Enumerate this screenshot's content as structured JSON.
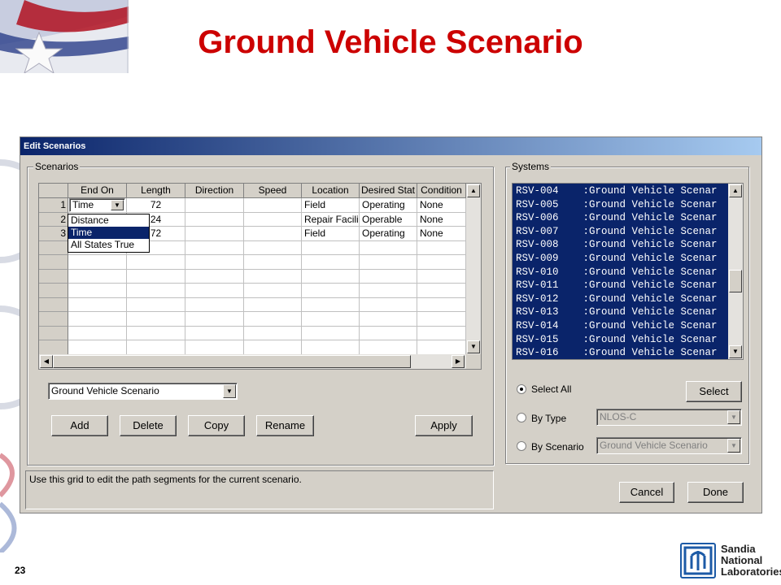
{
  "slide": {
    "title": "Ground Vehicle Scenario",
    "page_number": "23",
    "logo_text": [
      "Sandia",
      "National",
      "Laboratories"
    ]
  },
  "window": {
    "title": "Edit Scenarios",
    "scenarios_label": "Scenarios",
    "systems_label": "Systems",
    "grid": {
      "columns": [
        "End On",
        "Length",
        "Direction",
        "Speed",
        "Location",
        "Desired Stat",
        "Condition"
      ],
      "rows": [
        {
          "num": "1",
          "end_on": "Time",
          "length": "72",
          "direction": "",
          "speed": "",
          "location": "Field",
          "desired_state": "Operating",
          "condition": "None"
        },
        {
          "num": "2",
          "end_on": "",
          "length": "24",
          "direction": "",
          "speed": "",
          "location": "Repair Facili",
          "desired_state": "Operable",
          "condition": "None"
        },
        {
          "num": "3",
          "end_on": "",
          "length": "72",
          "direction": "",
          "speed": "",
          "location": "Field",
          "desired_state": "Operating",
          "condition": "None"
        }
      ],
      "end_on_options": [
        "Distance",
        "Time",
        "All States True"
      ],
      "end_on_selected": "Time"
    },
    "scenario_select": "Ground Vehicle Scenario",
    "buttons": {
      "add": "Add",
      "delete": "Delete",
      "copy": "Copy",
      "rename": "Rename",
      "apply": "Apply",
      "select": "Select",
      "cancel": "Cancel",
      "done": "Done"
    },
    "systems": [
      {
        "id": "RSV-004",
        "name": ":Ground Vehicle Scenar"
      },
      {
        "id": "RSV-005",
        "name": ":Ground Vehicle Scenar"
      },
      {
        "id": "RSV-006",
        "name": ":Ground Vehicle Scenar"
      },
      {
        "id": "RSV-007",
        "name": ":Ground Vehicle Scenar"
      },
      {
        "id": "RSV-008",
        "name": ":Ground Vehicle Scenar"
      },
      {
        "id": "RSV-009",
        "name": ":Ground Vehicle Scenar"
      },
      {
        "id": "RSV-010",
        "name": ":Ground Vehicle Scenar"
      },
      {
        "id": "RSV-011",
        "name": ":Ground Vehicle Scenar"
      },
      {
        "id": "RSV-012",
        "name": ":Ground Vehicle Scenar"
      },
      {
        "id": "RSV-013",
        "name": ":Ground Vehicle Scenar"
      },
      {
        "id": "RSV-014",
        "name": ":Ground Vehicle Scenar"
      },
      {
        "id": "RSV-015",
        "name": ":Ground Vehicle Scenar"
      },
      {
        "id": "RSV-016",
        "name": ":Ground Vehicle Scenar"
      }
    ],
    "selection": {
      "select_all": "Select All",
      "by_type": "By Type",
      "by_type_value": "NLOS-C",
      "by_scenario": "By Scenario",
      "by_scenario_value": "Ground Vehicle Scenario",
      "selected_option": "Select All"
    },
    "status_text": "Use this grid to edit the path segments for the current scenario.",
    "colors": {
      "title_red": "#cc0000",
      "selection_blue": "#0a246a",
      "dialog_gray": "#d4d0c8"
    }
  }
}
